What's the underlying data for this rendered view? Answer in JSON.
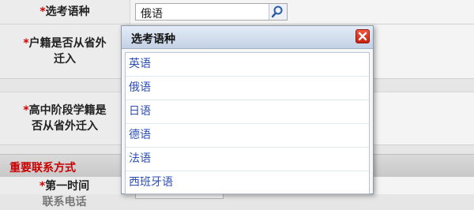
{
  "form": {
    "required_mark": "*",
    "lang_label": "选考语种",
    "lang_value": "俄语",
    "hukou_label_line1": "户籍是否从省外",
    "hukou_label_line2": "迁入",
    "hs_label_line1": "高中阶段学籍是",
    "hs_label_line2": "否从省外迁入",
    "section_title": "重要联系方式",
    "first_label_line1": "第一时间",
    "first_label_line2_cut": "联系电话"
  },
  "popup": {
    "title": "选考语种",
    "items": [
      "英语",
      "俄语",
      "日语",
      "德语",
      "法语",
      "西班牙语"
    ]
  },
  "icons": {
    "search": "magnifier-icon",
    "close": "close-x-icon"
  },
  "colors": {
    "required": "#d40000",
    "section_text": "#c80000",
    "item_text": "#2d4fb5",
    "close_bg": "#d8341c"
  }
}
